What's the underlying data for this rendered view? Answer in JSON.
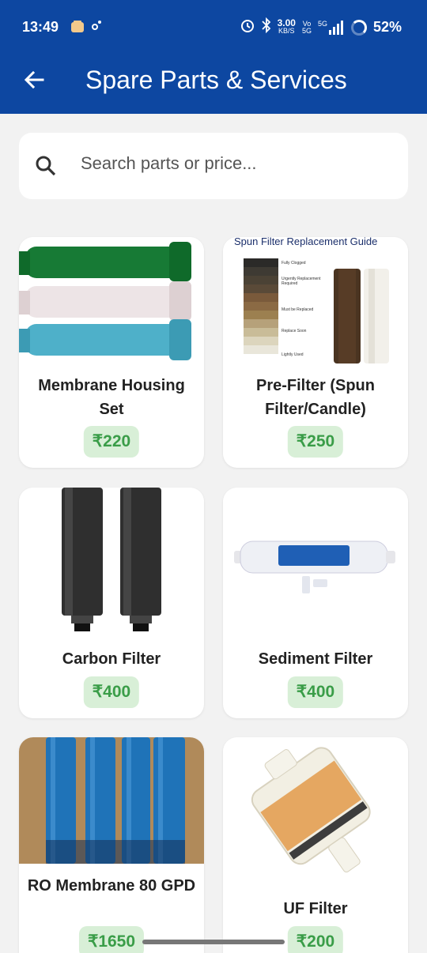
{
  "status": {
    "time": "13:49",
    "speed_top": "3.00",
    "speed_bottom": "KB/S",
    "volte_top": "Vo",
    "volte_bottom": "5G",
    "net": "5G",
    "battery": "52%"
  },
  "appbar": {
    "title": "Spare Parts & Services"
  },
  "search": {
    "placeholder": "Search parts or price..."
  },
  "guide": {
    "title": "Spun Filter Replacement Guide",
    "labels": [
      "Fully Clogged",
      "Urgently Replacement Required",
      "Must be Replaced",
      "Replace Soon",
      "Lightly Used"
    ]
  },
  "products": [
    {
      "name": "Membrane Housing Set",
      "price": "₹220"
    },
    {
      "name": "Pre-Filter (Spun Filter/Candle)",
      "price": "₹250"
    },
    {
      "name": "Carbon Filter",
      "price": "₹400"
    },
    {
      "name": "Sediment Filter",
      "price": "₹400"
    },
    {
      "name": "RO Membrane 80 GPD",
      "price": "₹1650"
    },
    {
      "name": "UF Filter",
      "price": "₹200"
    }
  ],
  "colors": {
    "primary": "#0d47a1",
    "price_bg": "#d8efd7",
    "price_text": "#3a9d48"
  }
}
